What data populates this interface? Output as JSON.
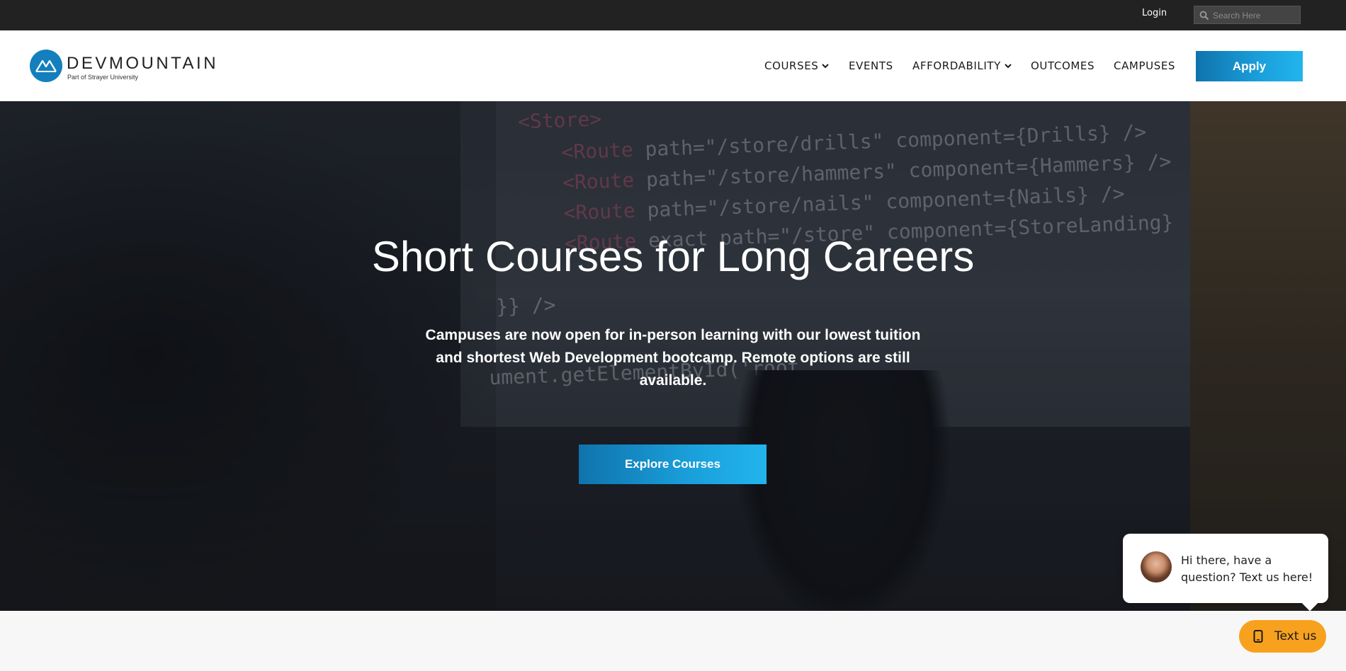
{
  "topbar": {
    "login_label": "Login",
    "search_placeholder": "Search Here",
    "search_icon": "search-icon"
  },
  "header": {
    "logo": {
      "wordmark": "DEVMOUNTAIN",
      "tagline": "Part of Strayer University",
      "icon": "mountain-logo-icon"
    },
    "nav": [
      {
        "label": "COURSES",
        "has_dropdown": true
      },
      {
        "label": "EVENTS",
        "has_dropdown": false
      },
      {
        "label": "AFFORDABILITY",
        "has_dropdown": true
      },
      {
        "label": "OUTCOMES",
        "has_dropdown": false
      },
      {
        "label": "CAMPUSES",
        "has_dropdown": false
      }
    ],
    "apply_label": "Apply"
  },
  "hero": {
    "title": "Short Courses for Long Careers",
    "text": "Campuses are now open for in-person learning with our lowest tuition and shortest Web Development bootcamp. Remote options are still available.",
    "cta_label": "Explore Courses"
  },
  "chat": {
    "message": "Hi there, have a question? Text us here!",
    "button_label": "Text us",
    "button_icon": "phone-icon"
  },
  "colors": {
    "topbar": "#222222",
    "accent_blue": "#1aa0db",
    "chat_orange": "#f7a11e"
  }
}
